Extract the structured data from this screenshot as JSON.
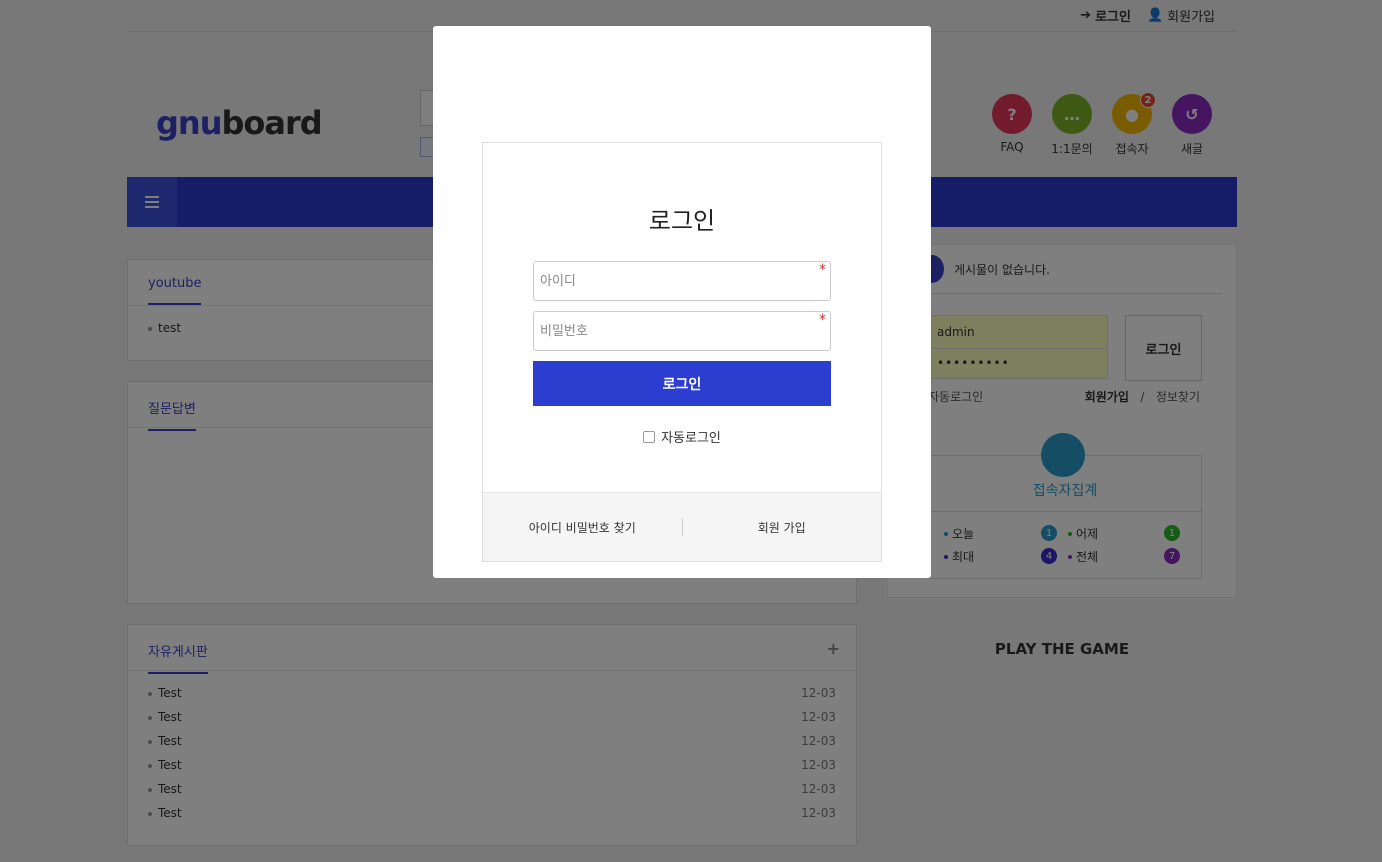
{
  "top_links": {
    "login": "로그인",
    "register": "회원가입"
  },
  "logo": {
    "part1": "gnu",
    "part2": "board"
  },
  "quick_menu": [
    {
      "label": "FAQ",
      "glyph": "?",
      "color": "#e2375a",
      "badge": ""
    },
    {
      "label": "1:1문의",
      "glyph": "…",
      "color": "#7cb228",
      "badge": ""
    },
    {
      "label": "접속자",
      "glyph": "●",
      "color": "#f2b800",
      "badge": "2"
    },
    {
      "label": "새글",
      "glyph": "↺",
      "color": "#8a2ac2",
      "badge": ""
    }
  ],
  "boards": {
    "youtube": {
      "title": "youtube",
      "items": [
        "test"
      ]
    },
    "qna": {
      "title": "질문답변"
    },
    "free": {
      "title": "자유게시판",
      "plus": "+",
      "items": [
        {
          "title": "Test",
          "date": "12-03"
        },
        {
          "title": "Test",
          "date": "12-03"
        },
        {
          "title": "Test",
          "date": "12-03"
        },
        {
          "title": "Test",
          "date": "12-03"
        },
        {
          "title": "Test",
          "date": "12-03"
        },
        {
          "title": "Test",
          "date": "12-03"
        }
      ]
    }
  },
  "sidebar": {
    "no_posts": "게시물이 없습니다.",
    "user_id": "admin",
    "password_mask": "•••••••••",
    "login_button": "로그인",
    "auto_login": "자동로그인",
    "register_link": "회원가입",
    "slash": "/",
    "find_link": "정보찾기",
    "stats_title": "접속자집계",
    "stats": {
      "today_label": "오늘",
      "today": "1",
      "yesterday_label": "어제",
      "yesterday": "1",
      "max_label": "최대",
      "max": "4",
      "total_label": "전체",
      "total": "7"
    }
  },
  "game_title": "PLAY THE GAME",
  "modal": {
    "title": "로그인",
    "id_placeholder": "아이디",
    "pw_placeholder": "비밀번호",
    "required_mark": "*",
    "submit_label": "로그인",
    "auto_login_label": "자동로그인",
    "find_label": "아이디 비밀번호 찾기",
    "register_label": "회원 가입"
  },
  "colors": {
    "accent": "#2c3ed0",
    "navbar": "#2a3bcc"
  }
}
